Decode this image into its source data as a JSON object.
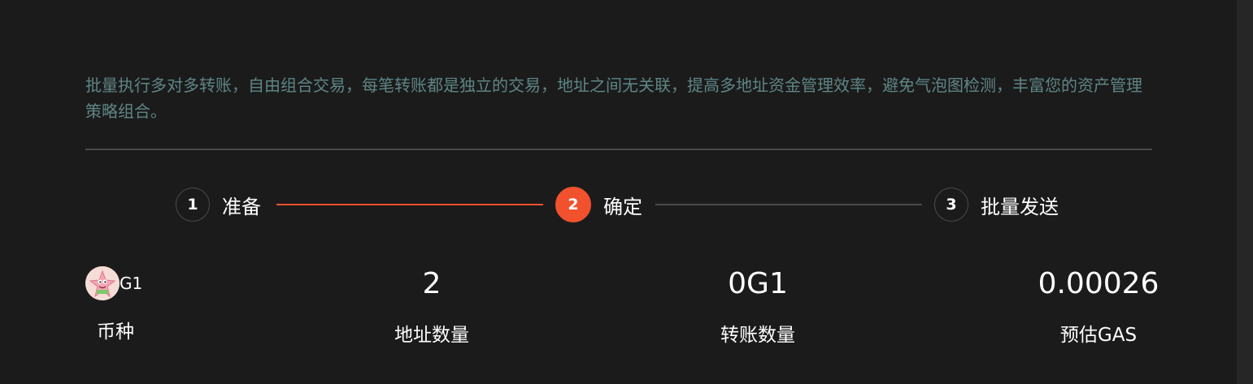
{
  "description": "批量执行多对多转账，自由组合交易，每笔转账都是独立的交易，地址之间无关联，提高多地址资金管理效率，避免气泡图检测，丰富您的资产管理策略组合。",
  "steps": [
    {
      "number": "1",
      "label": "准备"
    },
    {
      "number": "2",
      "label": "确定"
    },
    {
      "number": "3",
      "label": "批量发送"
    }
  ],
  "colors": {
    "accent": "#f2512e",
    "background": "#1b1b1b",
    "description_text": "#5f8585",
    "inactive_line": "#4a4a4a"
  },
  "summary": {
    "coin": {
      "name": "G1",
      "label": "币种",
      "avatar_icon": "starfish-avatar-icon"
    },
    "address_count": {
      "value": "2",
      "label": "地址数量"
    },
    "transfer_amount": {
      "value": "0G1",
      "label": "转账数量"
    },
    "estimated_gas": {
      "value": "0.00026",
      "label": "预估GAS"
    }
  }
}
